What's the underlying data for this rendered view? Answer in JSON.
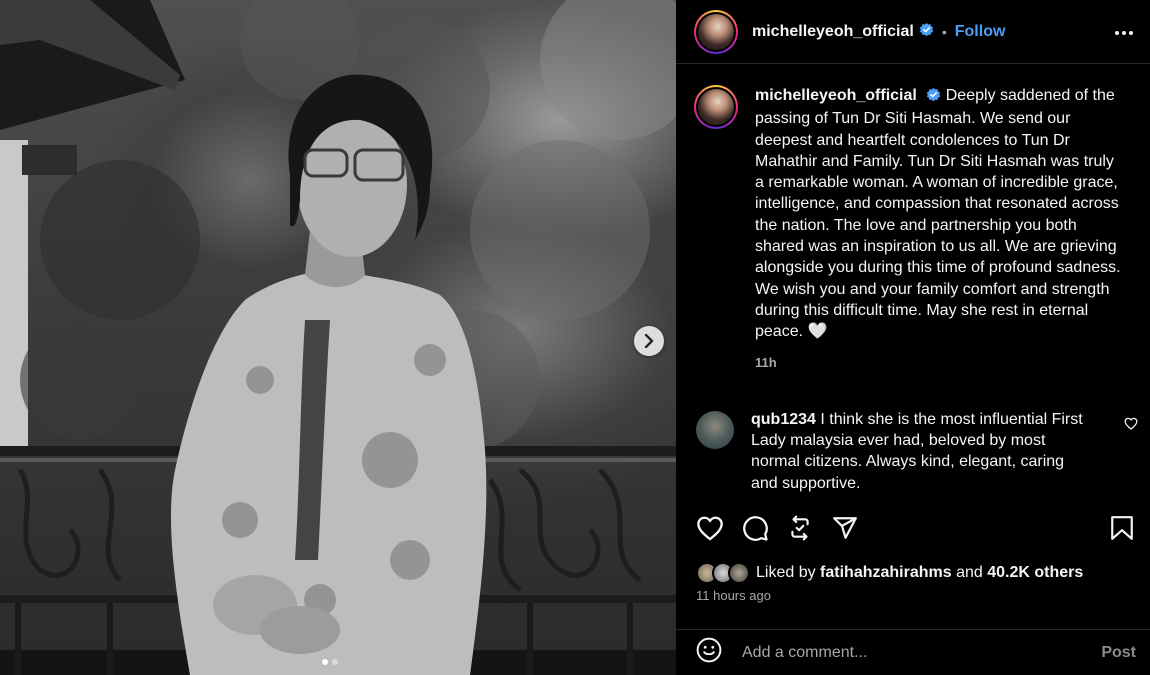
{
  "post": {
    "username": "michelleyeoh_official",
    "follow_label": "Follow",
    "separator": "•",
    "caption": "Deeply saddened of the passing of Tun Dr Siti Hasmah. We send our deepest and heartfelt condolences to Tun Dr Mahathir and Family. Tun Dr Siti Hasmah was truly a remarkable woman. A woman of incredible grace, intelligence, and compassion that resonated across the nation. The love and partnership you both shared was an inspiration to us all. We are grieving alongside you during this time of profound sadness. We wish you and your family comfort and strength during this difficult time. May she rest in eternal peace. 🤍",
    "caption_time": "11h"
  },
  "comments": [
    {
      "username": "qub1234",
      "text": "I think she is the most influential First Lady malaysia ever had, beloved by most normal citizens. Always kind, elegant, caring and supportive."
    }
  ],
  "likes": {
    "prefix": "Liked by",
    "user": "fatihahzahirahms",
    "and": "and",
    "others": "40.2K others"
  },
  "post_time": "11 hours ago",
  "comment_box": {
    "placeholder": "Add a comment...",
    "post_label": "Post"
  },
  "carousel": {
    "slide_count": 2,
    "current_slide": 1
  },
  "colors": {
    "accent": "#4a9df8",
    "background": "#000000",
    "muted": "#a8a8a8"
  },
  "icons": [
    "verified-badge-icon",
    "more-options-icon",
    "heart-icon",
    "comment-icon",
    "repost-icon",
    "share-icon",
    "bookmark-icon",
    "emoji-icon",
    "chevron-right-icon"
  ]
}
